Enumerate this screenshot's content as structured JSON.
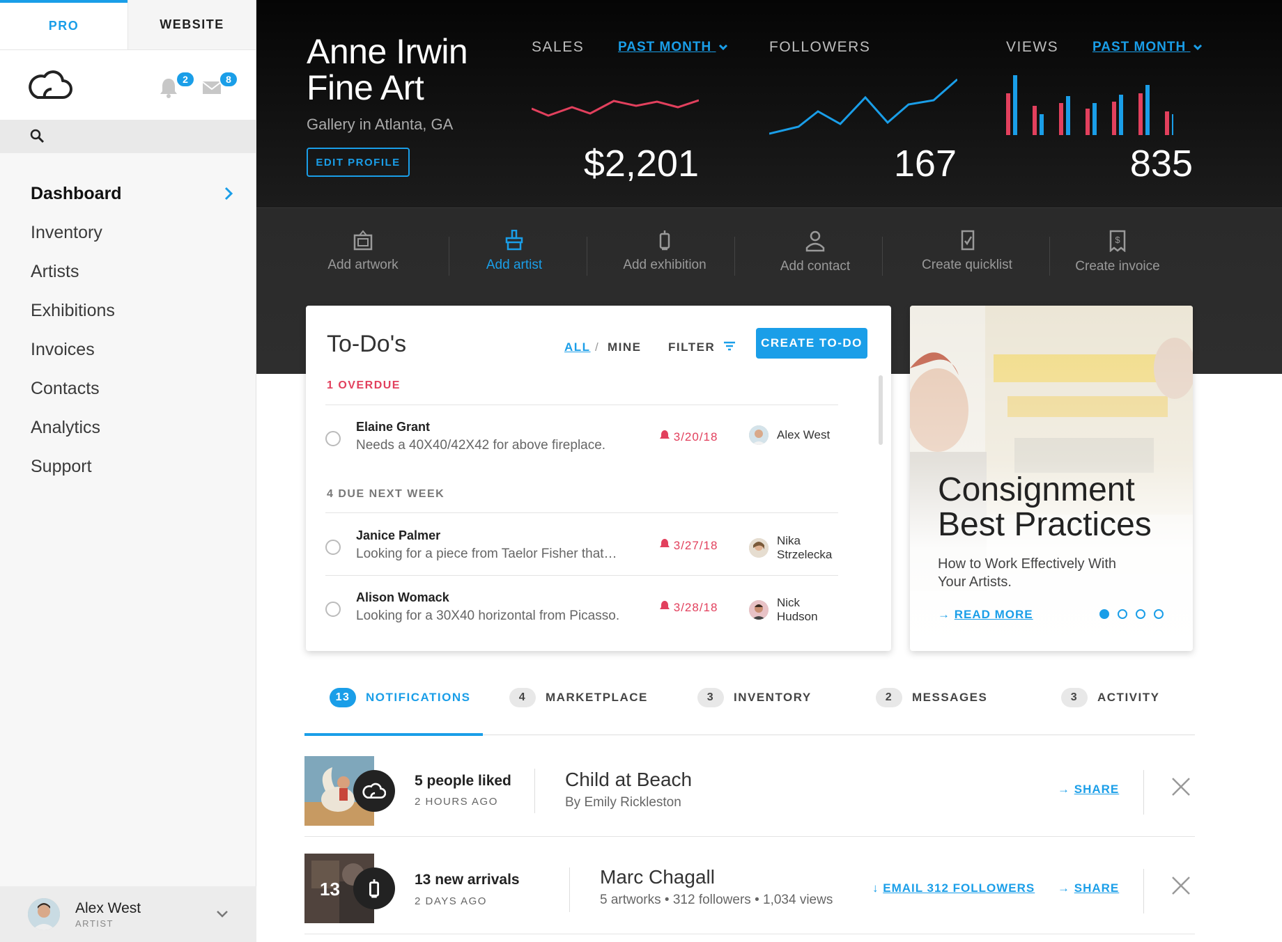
{
  "sidebar": {
    "tabs": [
      {
        "label": "PRO"
      },
      {
        "label": "WEBSITE"
      }
    ],
    "notifications_count": "2",
    "messages_count": "8",
    "nav": [
      {
        "label": "Dashboard"
      },
      {
        "label": "Inventory"
      },
      {
        "label": "Artists"
      },
      {
        "label": "Exhibitions"
      },
      {
        "label": "Invoices"
      },
      {
        "label": "Contacts"
      },
      {
        "label": "Analytics"
      },
      {
        "label": "Support"
      }
    ],
    "user": {
      "name": "Alex West",
      "role": "ARTIST"
    }
  },
  "header": {
    "title_line1": "Anne Irwin",
    "title_line2": "Fine Art",
    "subtitle": "Gallery in Atlanta, GA",
    "edit_label": "EDIT PROFILE",
    "stats": [
      {
        "label": "SALES",
        "period": "PAST MONTH",
        "value": "$2,201",
        "color": "#e2405d"
      },
      {
        "label": "FOLLOWERS",
        "value": "167",
        "color": "#1a9ee8"
      },
      {
        "label": "VIEWS",
        "period": "PAST MONTH",
        "value": "835"
      }
    ]
  },
  "actions": [
    {
      "label": "Add artwork"
    },
    {
      "label": "Add artist"
    },
    {
      "label": "Add exhibition"
    },
    {
      "label": "Add contact"
    },
    {
      "label": "Create quicklist"
    },
    {
      "label": "Create invoice"
    }
  ],
  "todos": {
    "title": "To-Do's",
    "all": "ALL",
    "sep": "/",
    "mine": "MINE",
    "filter": "FILTER",
    "create": "CREATE TO-DO",
    "overdue_header": "1 OVERDUE",
    "next_week_header": "4 DUE NEXT WEEK",
    "items": [
      {
        "name": "Elaine Grant",
        "desc": "Needs a 40X40/42X42 for above fireplace.",
        "date": "3/20/18",
        "person": "Alex West"
      },
      {
        "name": "Janice Palmer",
        "desc": "Looking for a piece from Taelor Fisher that…",
        "date": "3/27/18",
        "person": "Nika Strzelecka"
      },
      {
        "name": "Alison Womack",
        "desc": "Looking for a 30X40 horizontal from Picasso.",
        "date": "3/28/18",
        "person": "Nick Hudson"
      }
    ]
  },
  "promo": {
    "title_line1": "Consignment",
    "title_line2": "Best Practices",
    "subtitle": "How to Work Effectively With Your Artists.",
    "read_more": "READ MORE",
    "arrow": "→"
  },
  "notification_tabs": [
    {
      "count": "13",
      "label": "NOTIFICATIONS"
    },
    {
      "count": "4",
      "label": "MARKETPLACE"
    },
    {
      "count": "3",
      "label": "INVENTORY"
    },
    {
      "count": "2",
      "label": "MESSAGES"
    },
    {
      "count": "3",
      "label": "ACTIVITY"
    }
  ],
  "notifications": [
    {
      "main": "5 people liked",
      "time": "2 HOURS AGO",
      "title": "Child at Beach",
      "sub": "By Emily Rickleston",
      "share": "SHARE"
    },
    {
      "thumb_count": "13",
      "main": "13 new arrivals",
      "time": "2 DAYS AGO",
      "title": "Marc Chagall",
      "sub": "5 artworks • 312 followers • 1,034 views",
      "email": "EMAIL 312 FOLLOWERS",
      "share": "SHARE"
    }
  ],
  "glyphs": {
    "arrow_right": "→",
    "arrow_down": "↓"
  },
  "colors": {
    "accent": "#1a9ee8",
    "alert": "#e2405d"
  }
}
